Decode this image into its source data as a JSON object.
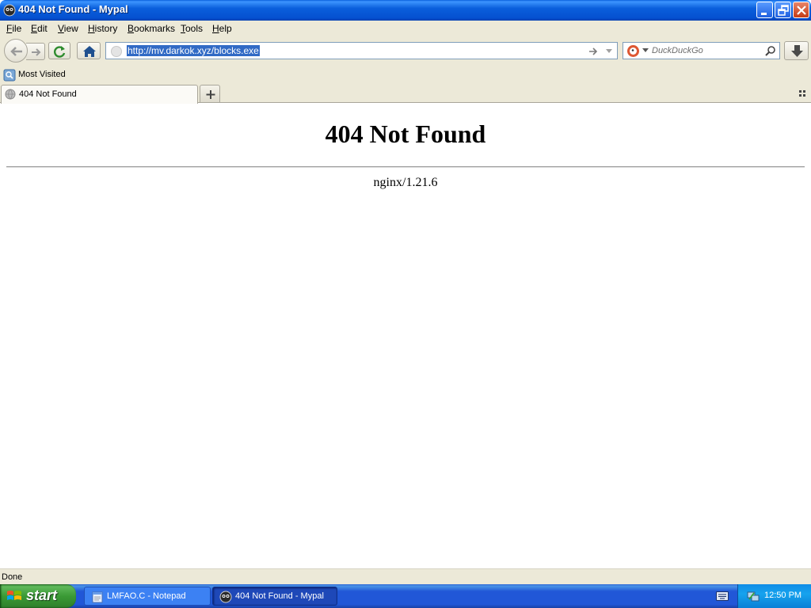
{
  "window": {
    "title": "404 Not Found - Mypal"
  },
  "menu": {
    "items": [
      "File",
      "Edit",
      "View",
      "History",
      "Bookmarks",
      "Tools",
      "Help"
    ]
  },
  "navbar": {
    "url": "http://mv.darkok.xyz/blocks.exe",
    "search_placeholder": "DuckDuckGo"
  },
  "bookmarks": {
    "most_visited": "Most Visited"
  },
  "tabs": [
    {
      "label": "404 Not Found",
      "active": true
    }
  ],
  "page": {
    "heading": "404 Not Found",
    "server": "nginx/1.21.6"
  },
  "status": {
    "text": "Done"
  },
  "taskbar": {
    "start_label": "start",
    "tasks": [
      {
        "label": "LMFAO.C - Notepad",
        "active": false
      },
      {
        "label": "404 Not Found - Mypal",
        "active": true
      }
    ],
    "clock": "12:50 PM"
  },
  "colors": {
    "titlebar": "#0a5fdc",
    "chrome": "#ece9d8",
    "url_highlight": "#316ac5",
    "taskbar": "#2157d7",
    "start_button": "#3a9a35",
    "tray": "#0f8ce6"
  },
  "icons": [
    "mypal-logo-icon",
    "minimize-icon",
    "maximize-icon",
    "close-icon",
    "back-arrow-icon",
    "forward-arrow-icon",
    "reload-icon",
    "home-icon",
    "globe-icon",
    "go-arrow-icon",
    "dropdown-icon",
    "duckduckgo-icon",
    "search-icon",
    "download-icon",
    "bookmark-folder-icon",
    "plus-icon",
    "list-all-tabs-icon",
    "windows-flag-icon",
    "notepad-icon",
    "keyboard-icon",
    "network-icon"
  ]
}
